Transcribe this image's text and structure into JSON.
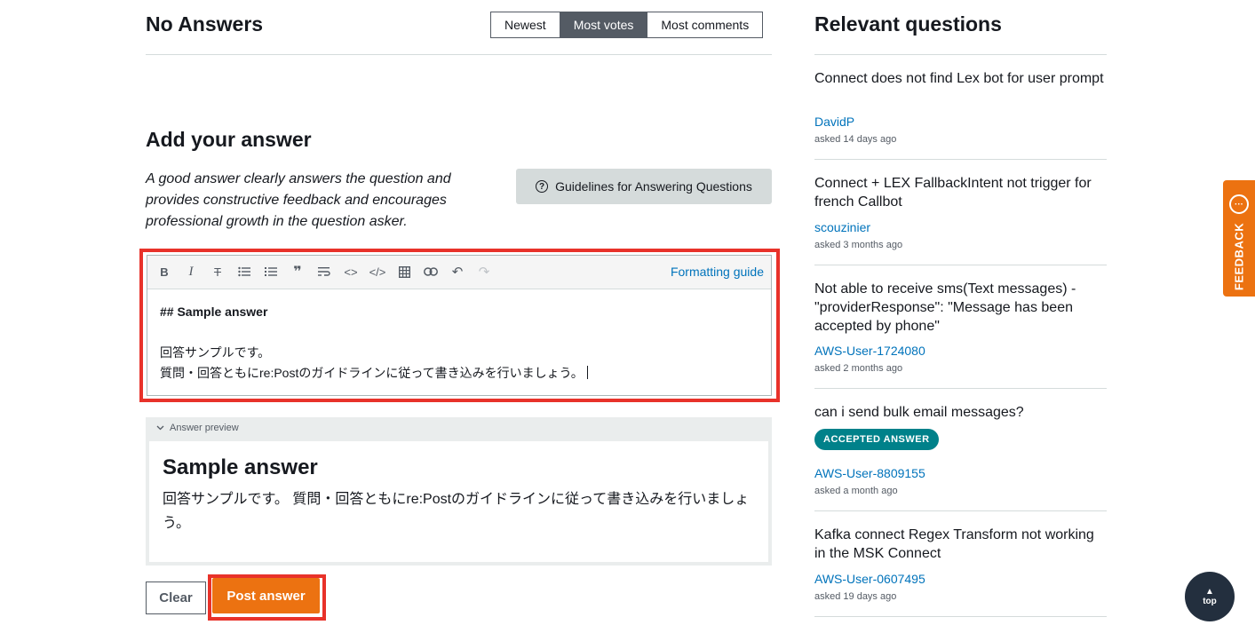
{
  "answers": {
    "heading": "No Answers",
    "sort_options": [
      "Newest",
      "Most votes",
      "Most comments"
    ],
    "sort_active": "Most votes"
  },
  "add_answer": {
    "heading": "Add your answer",
    "intro": "A good answer clearly answers the question and provides constructive feedback and encourages professional growth in the question asker.",
    "guidelines_button": "Guidelines for Answering Questions"
  },
  "editor": {
    "toolbar_icons": [
      "bold-icon",
      "italic-icon",
      "strikethrough-icon",
      "bulleted-list-icon",
      "numbered-list-icon",
      "quote-icon",
      "wrap-icon",
      "inline-code-icon",
      "code-block-icon",
      "table-icon",
      "link-icon",
      "undo-icon",
      "redo-icon"
    ],
    "formatting_guide": "Formatting guide",
    "line1": "## Sample answer",
    "line2": "",
    "line3": "回答サンプルです。",
    "line4": "質問・回答ともにre:Postのガイドラインに従って書き込みを行いましょう。"
  },
  "preview": {
    "label": "Answer preview",
    "heading": "Sample answer",
    "text": "回答サンプルです。 質問・回答ともにre:Postのガイドラインに従って書き込みを行いましょう。"
  },
  "actions": {
    "clear": "Clear",
    "post": "Post answer"
  },
  "sidebar": {
    "heading": "Relevant questions",
    "questions": [
      {
        "title": "Connect does not find Lex bot for user prompt",
        "user": "DavidP",
        "meta": "asked 14 days ago"
      },
      {
        "title": "Connect + LEX FallbackIntent not trigger for french Callbot",
        "user": "scouzinier",
        "meta": "asked 3 months ago"
      },
      {
        "title": "Not able to receive sms(Text messages) - \"providerResponse\": \"Message has been accepted by phone\"",
        "user": "AWS-User-1724080",
        "meta": "asked 2 months ago"
      },
      {
        "title": "can i send bulk email messages?",
        "badge": "ACCEPTED ANSWER",
        "user": "AWS-User-8809155",
        "meta": "asked a month ago"
      },
      {
        "title": "Kafka connect Regex Transform not working in the MSK Connect",
        "user": "AWS-User-0607495",
        "meta": "asked 19 days ago"
      }
    ]
  },
  "feedback": {
    "label": "FEEDBACK"
  },
  "top_button": {
    "label": "top"
  },
  "colors": {
    "accent": "#ec7211",
    "link": "#0073bb",
    "highlight": "#e8322a",
    "badge": "#00818a"
  }
}
